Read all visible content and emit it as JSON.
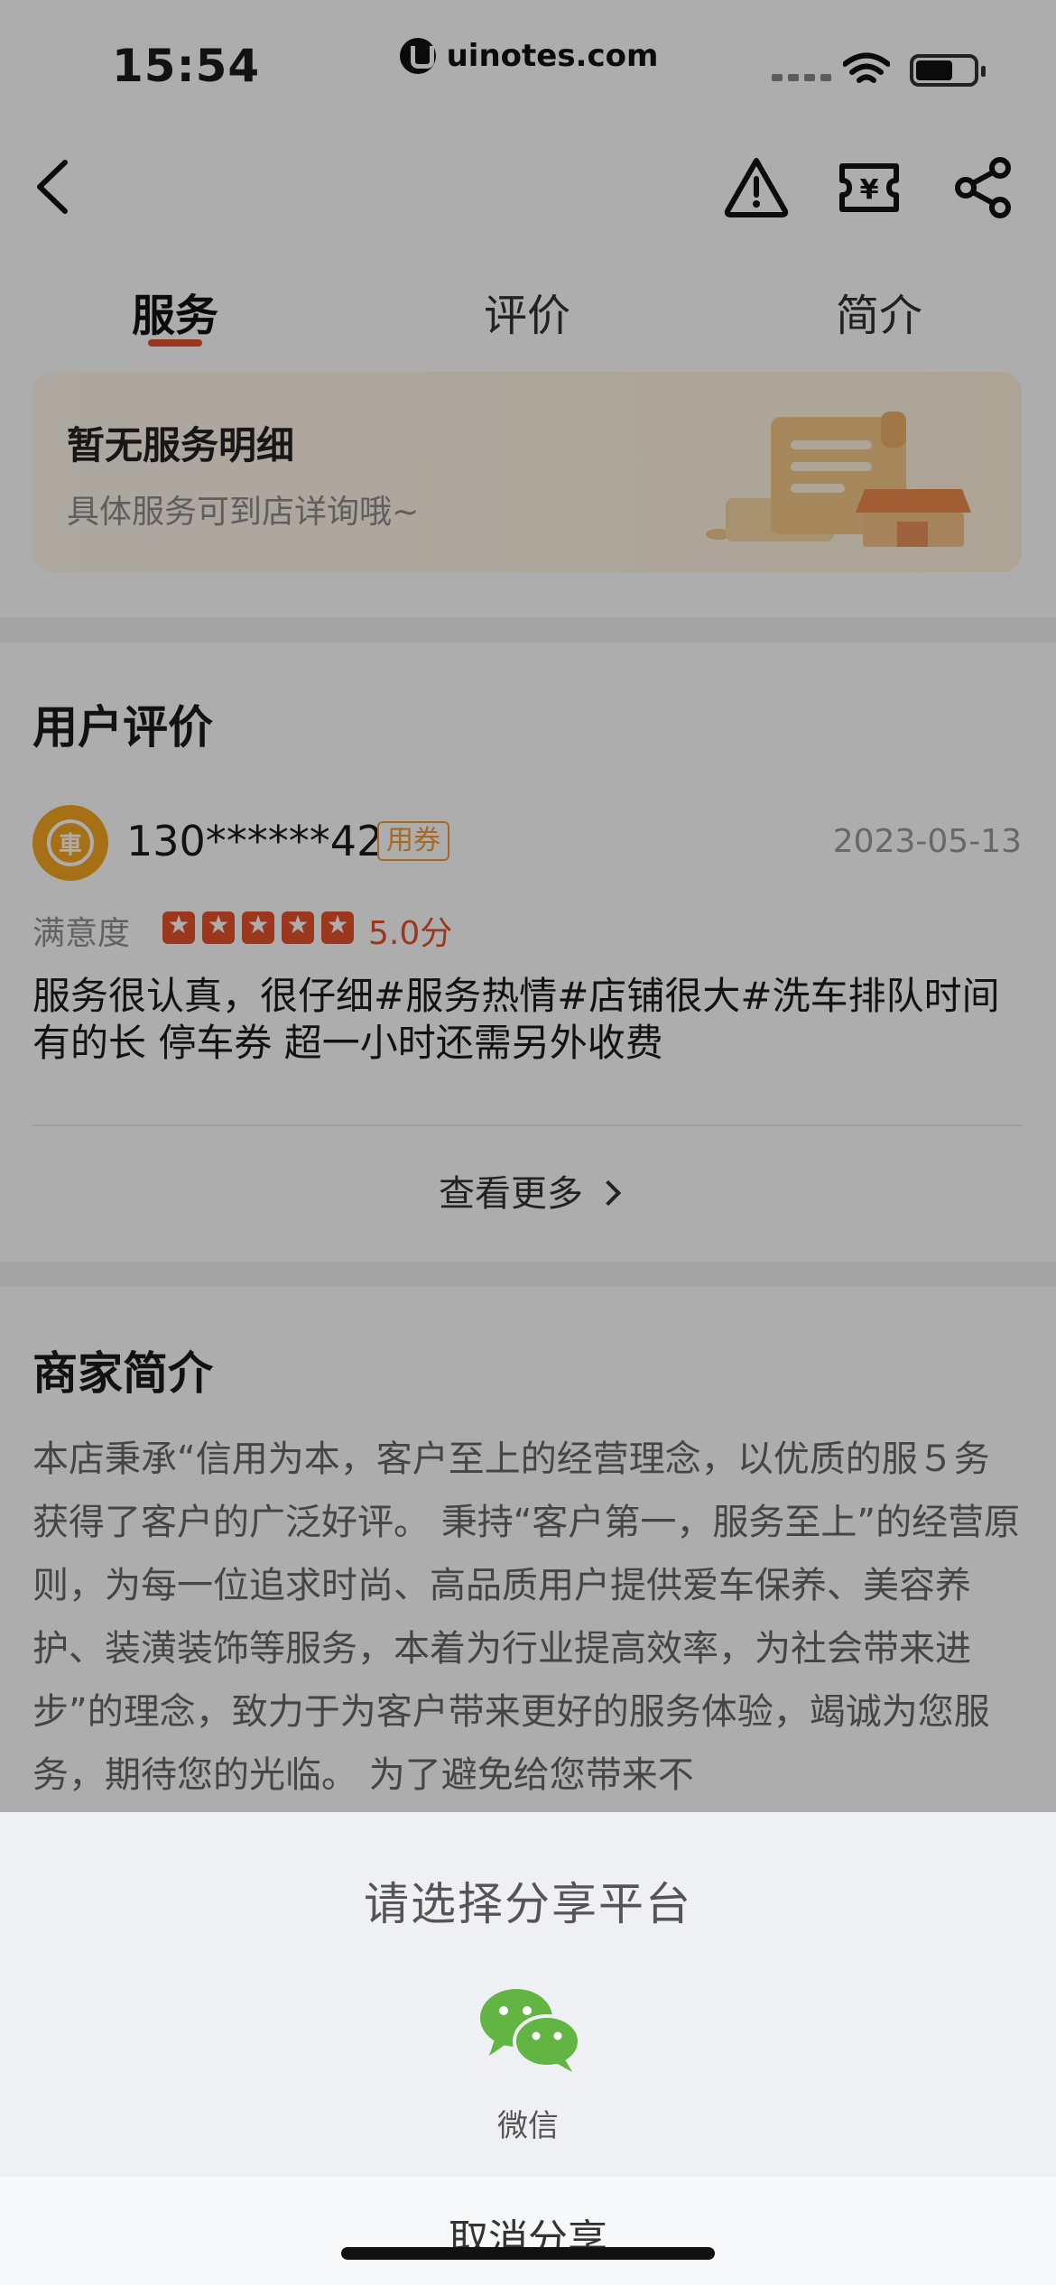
{
  "status_bar": {
    "time": "15:54",
    "watermark": "uinotes.com"
  },
  "nav": {
    "icons": [
      "back-icon",
      "alert-icon",
      "coupon-icon",
      "share-icon"
    ]
  },
  "tabs": [
    {
      "label": "服务",
      "active": true
    },
    {
      "label": "评价",
      "active": false
    },
    {
      "label": "简介",
      "active": false
    }
  ],
  "service": {
    "title": "暂无服务明细",
    "subtitle": "具体服务可到店详询哦~"
  },
  "reviews": {
    "section_title": "用户评价",
    "item": {
      "reviewer": "130******42",
      "tag": "用券",
      "date": "2023-05-13",
      "satisfaction_label": "满意度",
      "stars": 5,
      "score": "5.0分",
      "text": "服务很认真，很仔细#服务热情#店铺很大#洗车排队时间有的长   停车券  超一小时还需另外收费"
    },
    "see_more": "查看更多"
  },
  "merchant": {
    "section_title": "商家简介",
    "intro": "本店秉承“信用为本，客户至上的经营理念，以优质的服５务获得了客户的广泛好评。 秉持“客户第一，服务至上”的经营原则，为每一位追求时尚、高品质用户提供爱车保养、美容养护、装潢装饰等服务，本着为行业提高效率，为社会带来进步”的理念，致力于为客户带来更好的服务体验，竭诚为您服务，期待您的光临。 为了避免给您带来不"
  },
  "share_sheet": {
    "title": "请选择分享平台",
    "platforms": [
      {
        "label": "微信",
        "icon": "wechat-icon"
      }
    ],
    "cancel": "取消分享"
  },
  "colors": {
    "accent": "#e5512a",
    "coupon": "#f29d38",
    "wechat": "#62b543",
    "overlay": "rgba(0,0,0,0.32)"
  }
}
